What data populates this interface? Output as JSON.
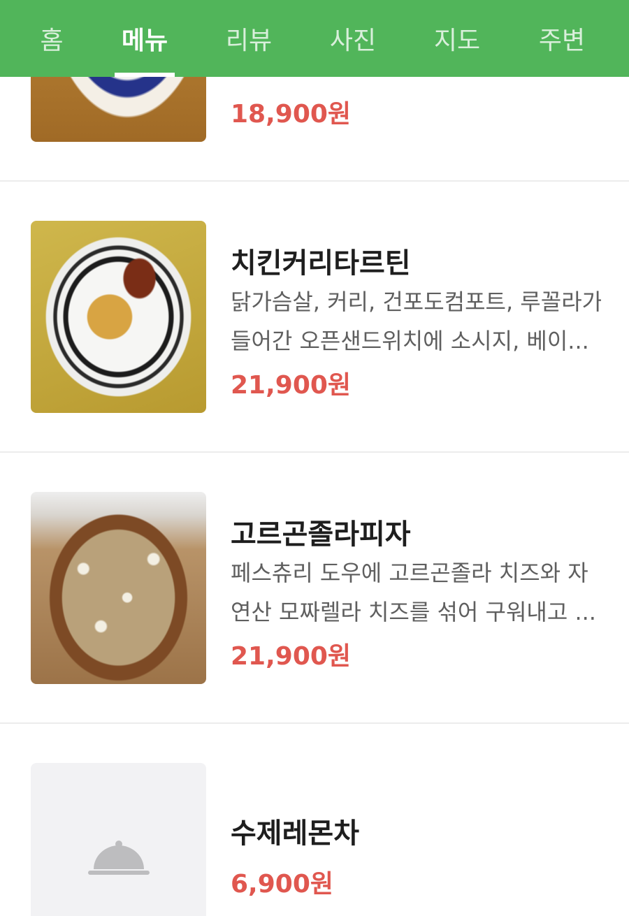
{
  "tabs": [
    {
      "label": "홈",
      "active": false
    },
    {
      "label": "메뉴",
      "active": true
    },
    {
      "label": "리뷰",
      "active": false
    },
    {
      "label": "사진",
      "active": false
    },
    {
      "label": "지도",
      "active": false
    },
    {
      "label": "주변",
      "active": false
    }
  ],
  "colors": {
    "header": "#51b55a",
    "price": "#e0574f"
  },
  "menu": [
    {
      "name": "",
      "description": [],
      "price": "18,900원",
      "photo": "pasta-dish-photo"
    },
    {
      "name": "치킨커리타르틴",
      "description": [
        "닭가슴살, 커리, 건포도컴포트, 루꼴라가",
        "들어간 오픈샌드위치에 소시지, 베이..."
      ],
      "price": "21,900원",
      "photo": "chicken-curry-tartine-photo"
    },
    {
      "name": "고르곤졸라피자",
      "description": [
        "페스츄리 도우에 고르곤졸라 치즈와 자",
        "연산 모짜렐라 치즈를 섞어 구워내고 ..."
      ],
      "price": "21,900원",
      "photo": "gorgonzola-pizza-photo"
    },
    {
      "name": "수제레몬차",
      "description": [],
      "price": "6,900원",
      "photo": "food-cloche-placeholder-icon"
    }
  ]
}
